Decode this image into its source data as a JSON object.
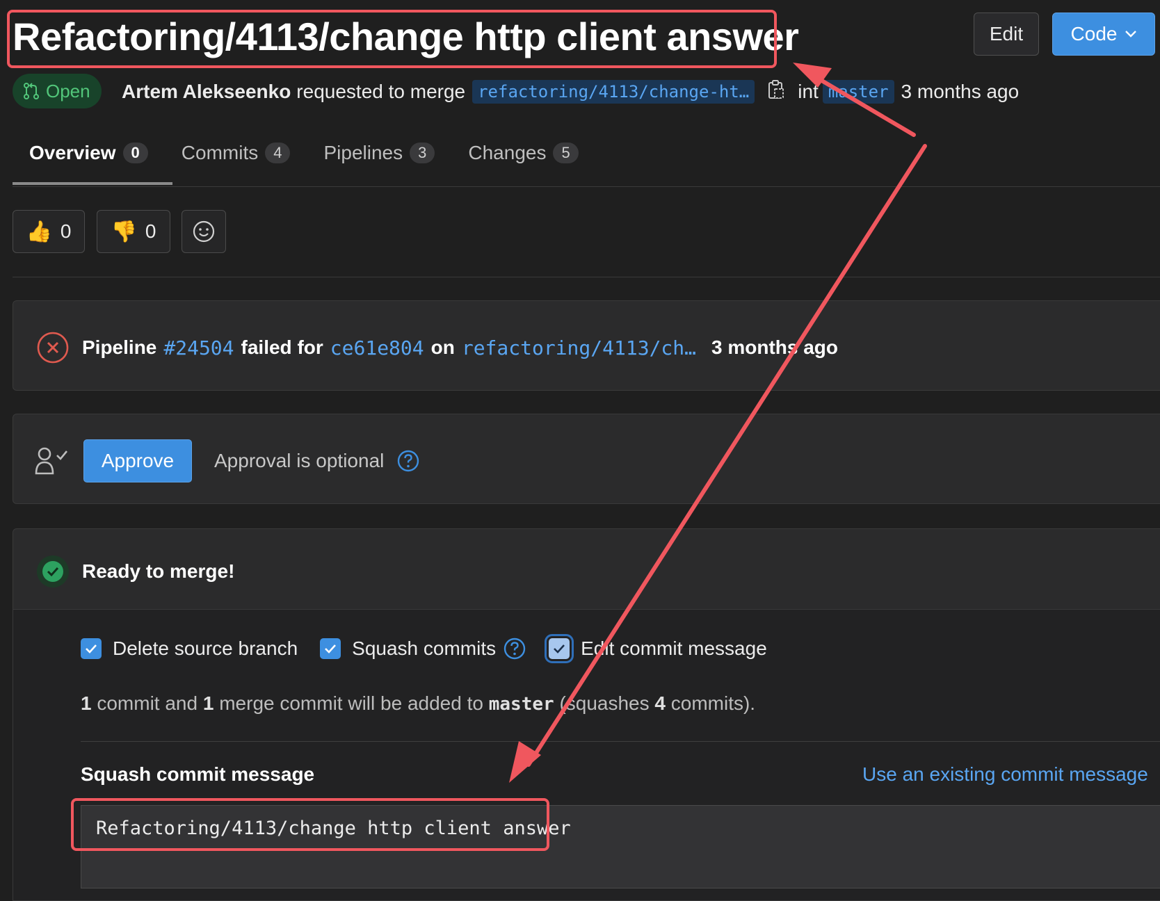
{
  "header": {
    "title": "Refactoring/4113/change http client answer",
    "edit_label": "Edit",
    "code_label": "Code"
  },
  "meta": {
    "status": "Open",
    "author": "Artem Alekseenko",
    "action": "requested to merge",
    "source_branch": "refactoring/4113/change-ht…",
    "into_fragment": "int",
    "target_branch": "master",
    "time_ago": "3 months ago"
  },
  "tabs": [
    {
      "label": "Overview",
      "count": "0"
    },
    {
      "label": "Commits",
      "count": "4"
    },
    {
      "label": "Pipelines",
      "count": "3"
    },
    {
      "label": "Changes",
      "count": "5"
    }
  ],
  "reactions": {
    "thumbs_up": "0",
    "thumbs_down": "0"
  },
  "pipeline": {
    "word": "Pipeline",
    "id": "#24504",
    "failed_for": "failed for",
    "commit": "ce61e804",
    "on": "on",
    "branch": "refactoring/4113/ch…",
    "time": "3 months ago"
  },
  "approval": {
    "button": "Approve",
    "text": "Approval is optional"
  },
  "merge": {
    "ready": "Ready to merge!",
    "delete_source": "Delete source branch",
    "squash_commits": "Squash commits",
    "edit_message": "Edit commit message",
    "info_n1": "1",
    "info_t1": "commit and",
    "info_n2": "1",
    "info_t2": "merge commit will be added to",
    "info_branch": "master",
    "info_t3": "(squashes",
    "info_n3": "4",
    "info_t4": "commits).",
    "squash_label": "Squash commit message",
    "use_existing": "Use an existing commit message",
    "message_value": "Refactoring/4113/change http client answer"
  },
  "colors": {
    "accent": "#3d8fe0",
    "annotation": "#f0575e",
    "success": "#2da160",
    "danger": "#e05a4f"
  }
}
